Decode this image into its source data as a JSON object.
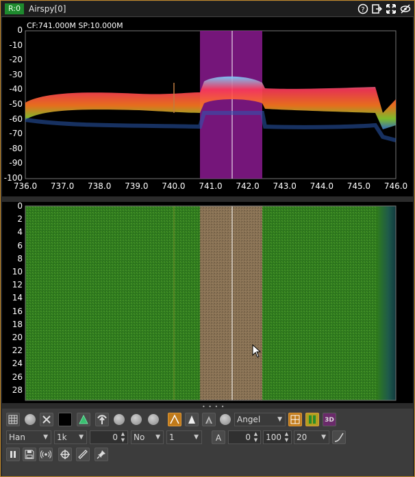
{
  "window": {
    "rx_badge": "R:0",
    "device_name": "Airspy[0]",
    "icons": [
      "help-icon",
      "export-icon",
      "maximize-icon",
      "hide-icon"
    ]
  },
  "spectrum": {
    "readout": "CF:741.000M SP:10.000M",
    "y_ticks": [
      "0",
      "-10",
      "-20",
      "-30",
      "-40",
      "-50",
      "-60",
      "-70",
      "-80",
      "-90",
      "-100"
    ],
    "x_ticks": [
      "736.0",
      "737.0",
      "738.0",
      "739.0",
      "740.0",
      "741.0",
      "742.0",
      "743.0",
      "744.0",
      "745.0",
      "746.0"
    ],
    "colors": {
      "channel_band": "#8a1a8f",
      "grid": "#777777",
      "center_line": "#ffffff"
    }
  },
  "waterfall": {
    "y_ticks": [
      "0",
      "2",
      "4",
      "6",
      "8",
      "10",
      "12",
      "14",
      "16",
      "18",
      "20",
      "22",
      "24",
      "26",
      "28"
    ],
    "colors": {
      "noise": "#2f7a1e",
      "signal": "#8a7355",
      "edge": "#1e5a4a"
    }
  },
  "controls": {
    "row1": {
      "palette_value": "Angel",
      "three_d_label": "3D"
    },
    "row2": {
      "window_value": "Han",
      "fft_size_value": "1k",
      "overlap_value": "0",
      "avg_mode_value": "No",
      "avg_value": "1",
      "auto_label": "A",
      "ref_value": "0",
      "range_value": "100",
      "fps_value": "20"
    }
  }
}
